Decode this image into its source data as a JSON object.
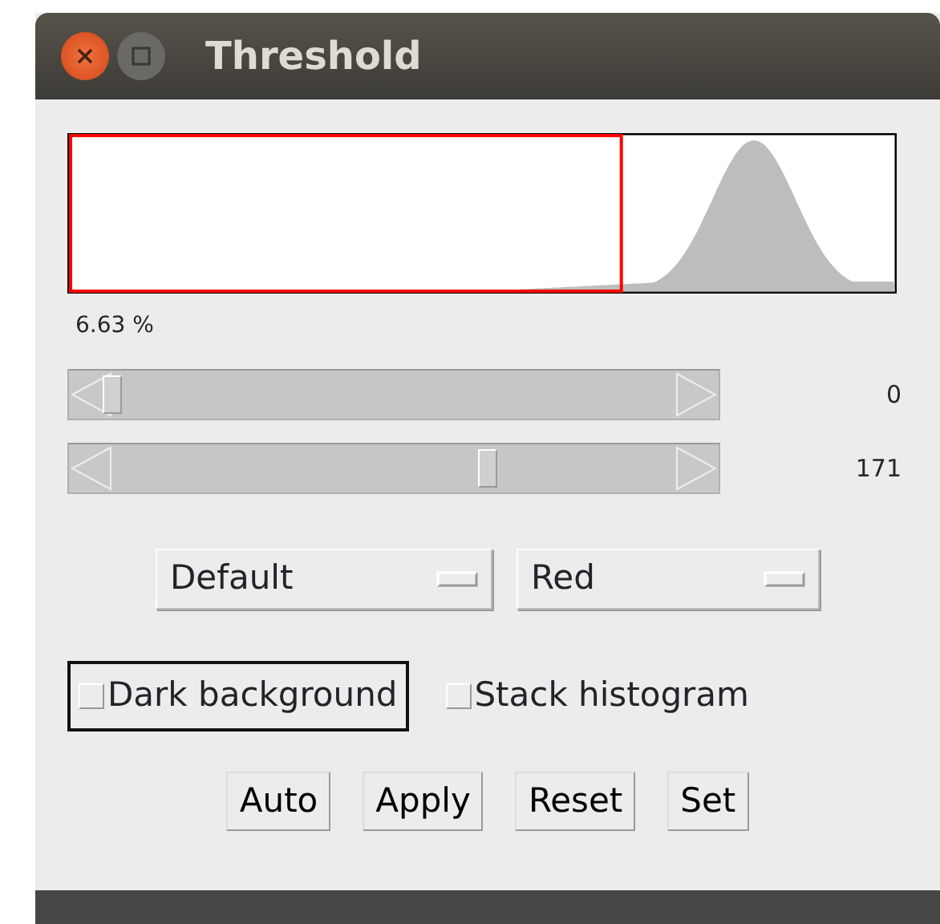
{
  "window": {
    "title": "Threshold"
  },
  "percent": "6.63 %",
  "sliders": [
    {
      "level": 0,
      "reading": "0"
    },
    {
      "level": 0.6706,
      "reading": "171"
    }
  ],
  "dropdowns": [
    {
      "value": "Default"
    },
    {
      "value": "Red"
    }
  ],
  "checkboxes": [
    {
      "label": "Dark background",
      "checked": false,
      "focused": true
    },
    {
      "label": "Stack histogram",
      "checked": false,
      "focused": false
    }
  ],
  "buttons": [
    "Auto",
    "Apply",
    "Reset",
    "Set"
  ]
}
